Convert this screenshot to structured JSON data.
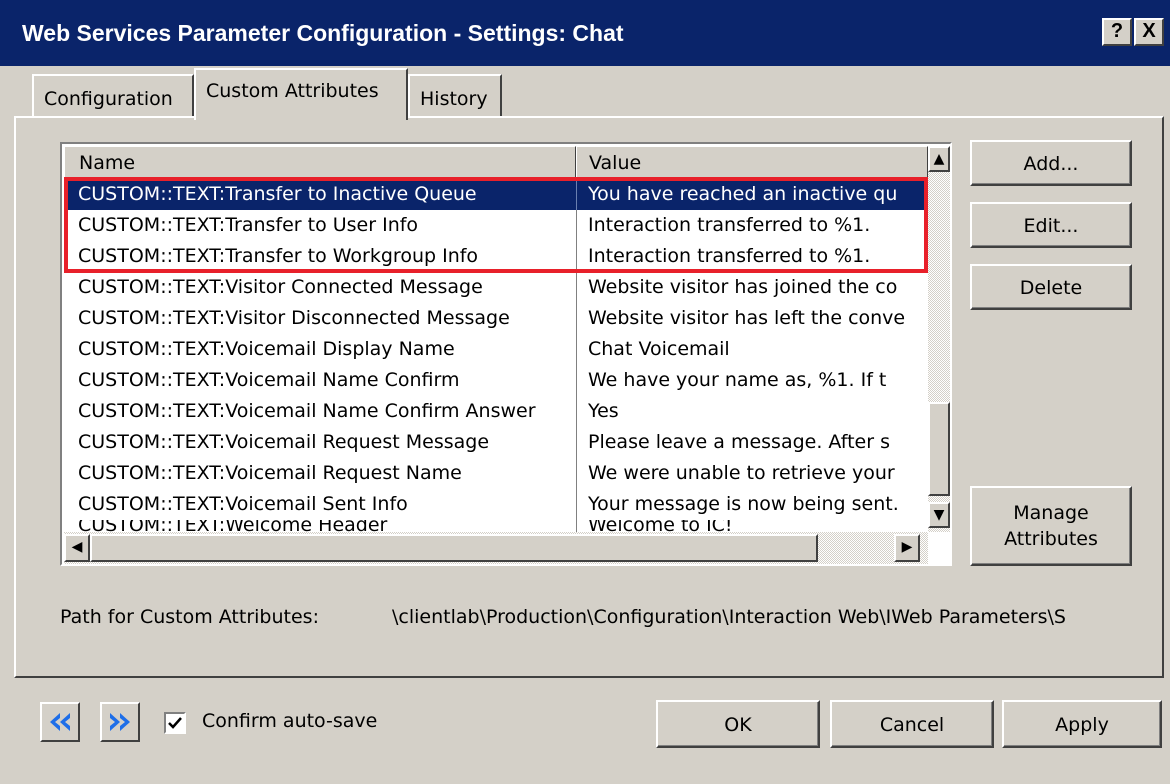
{
  "window": {
    "title": "Web Services Parameter Configuration - Settings: Chat",
    "help_label": "?",
    "close_label": "X"
  },
  "tabs": [
    {
      "label": "Configuration"
    },
    {
      "label": "Custom Attributes",
      "active": true
    },
    {
      "label": "History"
    }
  ],
  "table": {
    "columns": [
      "Name",
      "Value"
    ],
    "rows": [
      {
        "name": "CUSTOM::TEXT:Transfer to Inactive Queue",
        "value": "You have reached an inactive qu",
        "selected": true
      },
      {
        "name": "CUSTOM::TEXT:Transfer to User Info",
        "value": "Interaction transferred to %1."
      },
      {
        "name": "CUSTOM::TEXT:Transfer to Workgroup Info",
        "value": "Interaction transferred to %1."
      },
      {
        "name": "CUSTOM::TEXT:Visitor Connected Message",
        "value": "Website visitor has joined the co"
      },
      {
        "name": "CUSTOM::TEXT:Visitor Disconnected Message",
        "value": "Website visitor has left the conve"
      },
      {
        "name": "CUSTOM::TEXT:Voicemail Display Name",
        "value": "Chat Voicemail"
      },
      {
        "name": "CUSTOM::TEXT:Voicemail Name Confirm",
        "value": "We have your name as, %1. If t"
      },
      {
        "name": "CUSTOM::TEXT:Voicemail Name Confirm Answer",
        "value": "Yes"
      },
      {
        "name": "CUSTOM::TEXT:Voicemail Request Message",
        "value": "Please leave a message.  After s"
      },
      {
        "name": "CUSTOM::TEXT:Voicemail Request Name",
        "value": "We were unable to retrieve your"
      },
      {
        "name": "CUSTOM::TEXT:Voicemail Sent Info",
        "value": "Your message is now being sent."
      },
      {
        "name": "CUSTOM::TEXT:Welcome Header",
        "value": "Welcome to IC!"
      }
    ]
  },
  "side_buttons": {
    "add": "Add...",
    "edit": "Edit...",
    "delete": "Delete",
    "manage_line1": "Manage",
    "manage_line2": "Attributes"
  },
  "path": {
    "label": "Path for Custom Attributes:",
    "value": "\\clientlab\\Production\\Configuration\\Interaction Web\\IWeb Parameters\\S"
  },
  "footer": {
    "confirm_label": "Confirm auto-save",
    "confirm_checked": true,
    "ok": "OK",
    "cancel": "Cancel",
    "apply": "Apply"
  },
  "colors": {
    "titlebar": "#0a246a",
    "selection": "#0a246a",
    "highlight_box": "#e8202a",
    "nav_arrow": "#1e6ee8"
  },
  "icons": {
    "back": "double-left-arrow-icon",
    "forward": "double-right-arrow-icon"
  }
}
